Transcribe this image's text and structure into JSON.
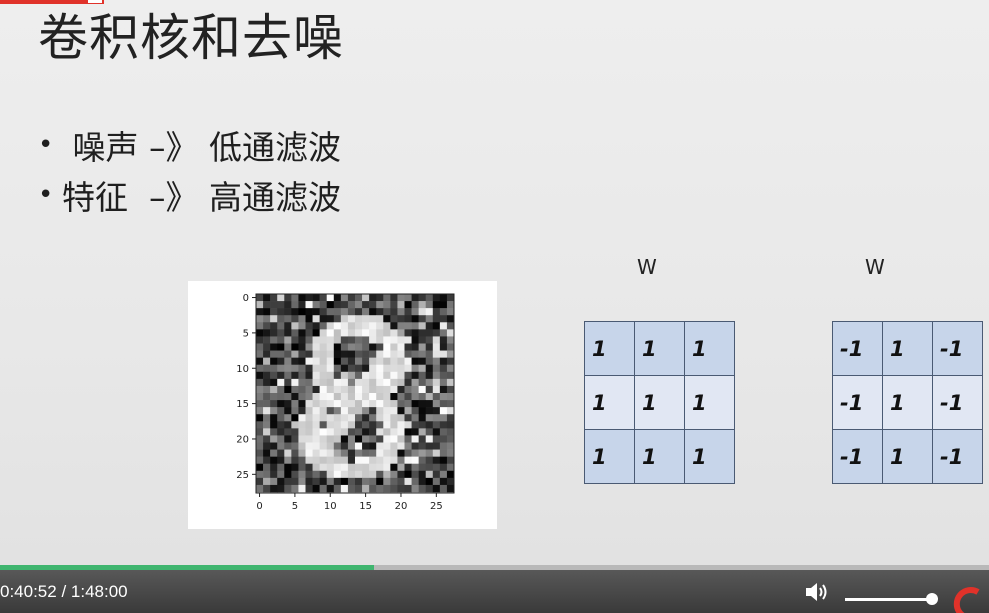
{
  "slide": {
    "title": "卷积核和去噪",
    "bullets": [
      {
        "marker": "•",
        "text": " 噪声 –》 低通滤波"
      },
      {
        "marker": "•",
        "text": "特征  –》 高通滤波"
      }
    ]
  },
  "figure": {
    "y_ticks": [
      "0",
      "5",
      "10",
      "15",
      "20",
      "25"
    ],
    "x_ticks": [
      "0",
      "5",
      "10",
      "15",
      "20",
      "25"
    ]
  },
  "kernels": [
    {
      "label": "W",
      "values": [
        [
          "1",
          "1",
          "1"
        ],
        [
          "1",
          "1",
          "1"
        ],
        [
          "1",
          "1",
          "1"
        ]
      ]
    },
    {
      "label": "W",
      "values": [
        [
          "-1",
          "1",
          "-1"
        ],
        [
          "-1",
          "1",
          "-1"
        ],
        [
          "-1",
          "1",
          "-1"
        ]
      ]
    }
  ],
  "player": {
    "time_display": "0:40:52  /  1:48:00",
    "progress_fraction": 0.378,
    "volume_fraction": 0.92,
    "volume_icon": "speaker-volume-icon",
    "logo_icon": "brand-logo-icon"
  },
  "colors": {
    "progress": "#3fb56f",
    "kernel_dark": "#c7d5ea",
    "kernel_light": "#e1e7f3",
    "accent_red": "#e0322a"
  }
}
